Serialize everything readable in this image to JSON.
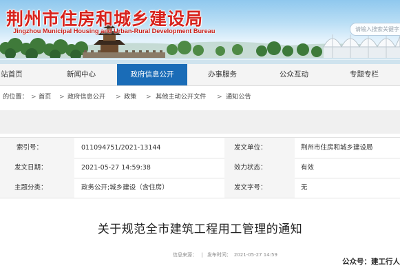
{
  "banner": {
    "title": "荆州市住房和城乡建设局",
    "subtitle": "Jingzhou Municipal Housing and Urban-Rural Development Bureau",
    "search_placeholder": "请输入搜索关键字"
  },
  "nav": {
    "items": [
      {
        "label": "站首页"
      },
      {
        "label": "新闻中心"
      },
      {
        "label": "政府信息公开"
      },
      {
        "label": "办事服务"
      },
      {
        "label": "公众互动"
      },
      {
        "label": "专题专栏"
      }
    ],
    "active_color": "#1a6cb7"
  },
  "breadcrumb": {
    "prefix": "的位置：",
    "items": [
      "首页",
      "政府信息公开",
      "政策",
      "其他主动公开文件",
      "通知公告"
    ],
    "separator": ">"
  },
  "info": {
    "index_label": "索引号：",
    "index_value": "011094751/2021-13144",
    "issuer_label": "发文单位：",
    "issuer_value": "荆州市住房和城乡建设局",
    "date_label": "发文日期：",
    "date_value": "2021-05-27 14:59:38",
    "status_label": "效力状态：",
    "status_value": "有效",
    "category_label": "主题分类：",
    "category_value": "政务公开;城乡建设（含住房）",
    "docno_label": "发文字号：",
    "docno_value": "无"
  },
  "article": {
    "title": "关于规范全市建筑工程用工管理的通知",
    "source_label": "信息来源：",
    "pub_label": "发布时间：",
    "pub_value": "2021-05-27 14:59"
  },
  "watermark": "公众号：建工行人",
  "colors": {
    "brand_red": "#d7221c",
    "nav_active": "#1a6cb7"
  }
}
